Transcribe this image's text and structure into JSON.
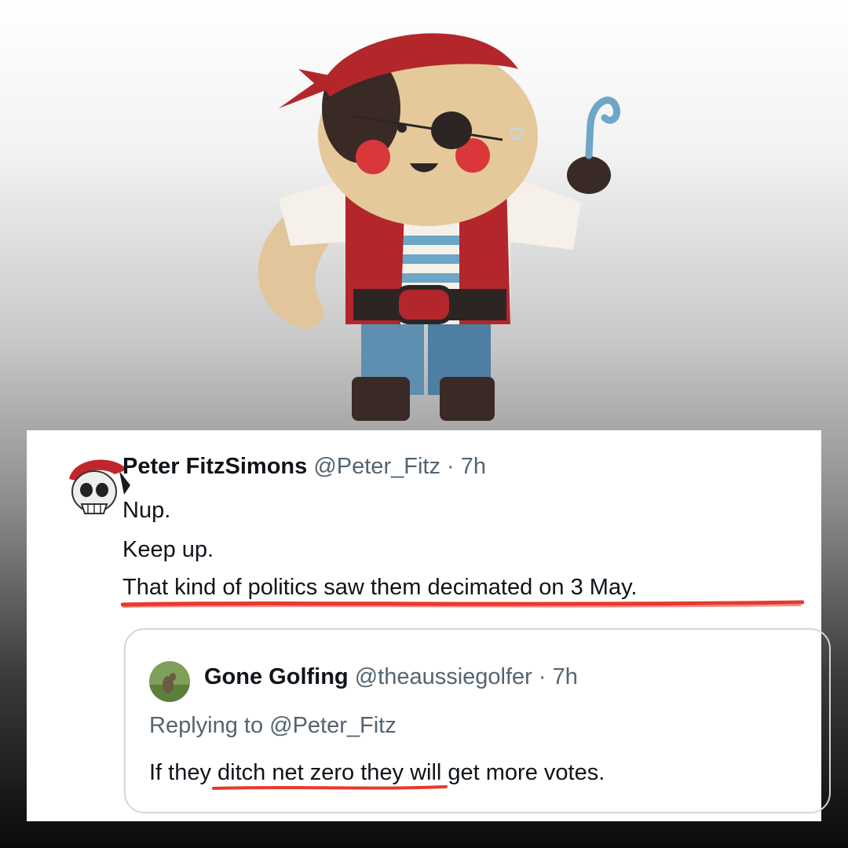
{
  "tweet": {
    "name": "Peter FitzSimons",
    "handle": "@Peter_Fitz",
    "separator": "·",
    "time": "7h",
    "lines": [
      "Nup.",
      "Keep up.",
      "That kind of politics saw them decimated on 3 May."
    ]
  },
  "quote": {
    "name": "Gone Golfing",
    "handle": "@theaussiegolfer",
    "separator": "·",
    "time": "7h",
    "reply_to": "Replying to @Peter_Fitz",
    "text": "If they ditch net zero they will get more votes."
  },
  "icons": {
    "main_avatar": "skull-pirate-avatar",
    "quote_avatar": "kangaroo-avatar"
  },
  "colors": {
    "highlight": "#e8392f",
    "muted": "#536471",
    "text": "#0f1419",
    "border": "#cfd9de"
  }
}
